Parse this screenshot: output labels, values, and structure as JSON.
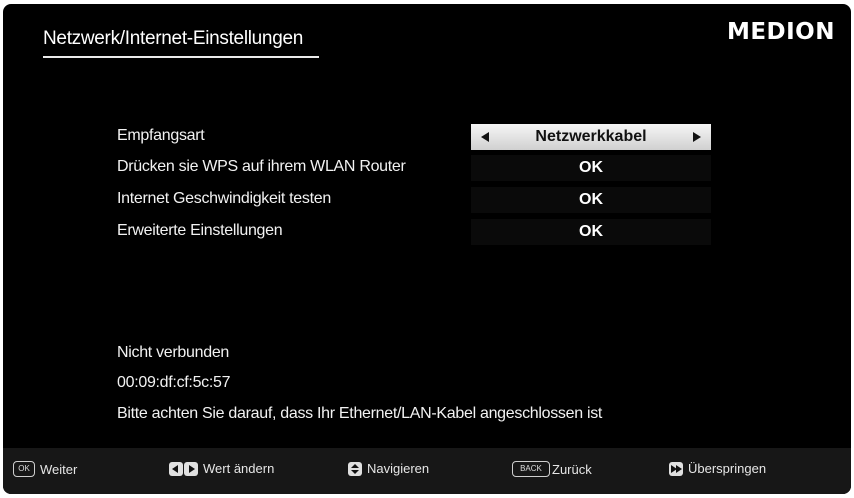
{
  "header": {
    "title": "Netzwerk/Internet-Einstellungen",
    "brand": "MEDION"
  },
  "settings": [
    {
      "label": "Empfangsart",
      "value": "Netzwerkkabel"
    },
    {
      "label": "Drücken sie WPS auf ihrem WLAN Router",
      "value": "OK"
    },
    {
      "label": "Internet Geschwindigkeit testen",
      "value": "OK"
    },
    {
      "label": "Erweiterte Einstellungen",
      "value": "OK"
    }
  ],
  "status": {
    "connection": "Nicht verbunden",
    "mac": "00:09:df:cf:5c:57",
    "hint": "Bitte achten Sie darauf, dass Ihr Ethernet/LAN-Kabel angeschlossen ist"
  },
  "footer": {
    "ok_key": "OK",
    "ok_label": "Weiter",
    "lr_label": "Wert ändern",
    "nav_label": "Navigieren",
    "back_key": "BACK",
    "back_label": "Zurück",
    "skip_label": "Überspringen"
  }
}
